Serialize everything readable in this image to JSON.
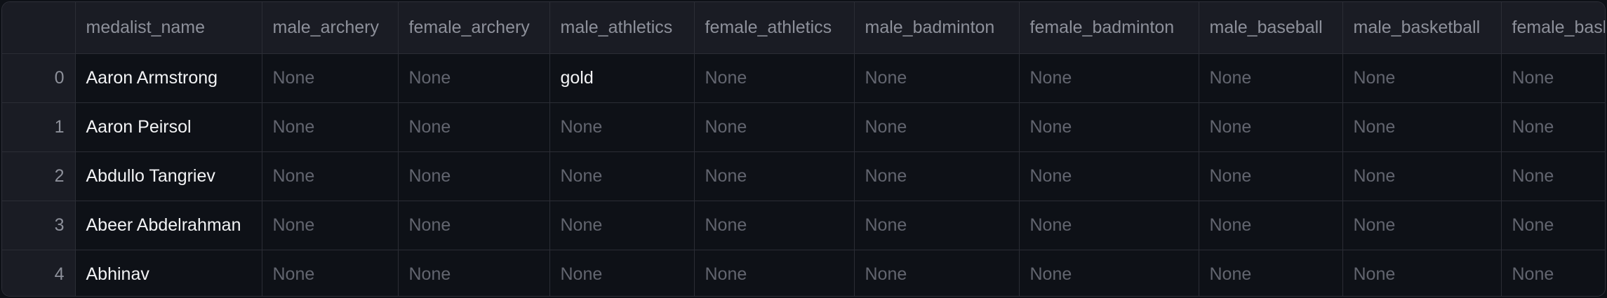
{
  "table": {
    "columns": [
      "medalist_name",
      "male_archery",
      "female_archery",
      "male_athletics",
      "female_athletics",
      "male_badminton",
      "female_badminton",
      "male_baseball",
      "male_basketball",
      "female_basketball"
    ],
    "rows": [
      {
        "index": "0",
        "cells": [
          "Aaron Armstrong",
          "None",
          "None",
          "gold",
          "None",
          "None",
          "None",
          "None",
          "None",
          "None"
        ]
      },
      {
        "index": "1",
        "cells": [
          "Aaron Peirsol",
          "None",
          "None",
          "None",
          "None",
          "None",
          "None",
          "None",
          "None",
          "None"
        ]
      },
      {
        "index": "2",
        "cells": [
          "Abdullo Tangriev",
          "None",
          "None",
          "None",
          "None",
          "None",
          "None",
          "None",
          "None",
          "None"
        ]
      },
      {
        "index": "3",
        "cells": [
          "Abeer Abdelrahman",
          "None",
          "None",
          "None",
          "None",
          "None",
          "None",
          "None",
          "None",
          "None"
        ]
      },
      {
        "index": "4",
        "cells": [
          "Abhinav",
          "None",
          "None",
          "None",
          "None",
          "None",
          "None",
          "None",
          "None",
          "None"
        ]
      }
    ]
  },
  "colors": {
    "background": "#0e1117",
    "header_background": "#1a1c24",
    "grid_line": "#2b2d35",
    "muted_text": "#62656f",
    "header_text": "#8d909a",
    "primary_text": "#f2f3f5"
  }
}
